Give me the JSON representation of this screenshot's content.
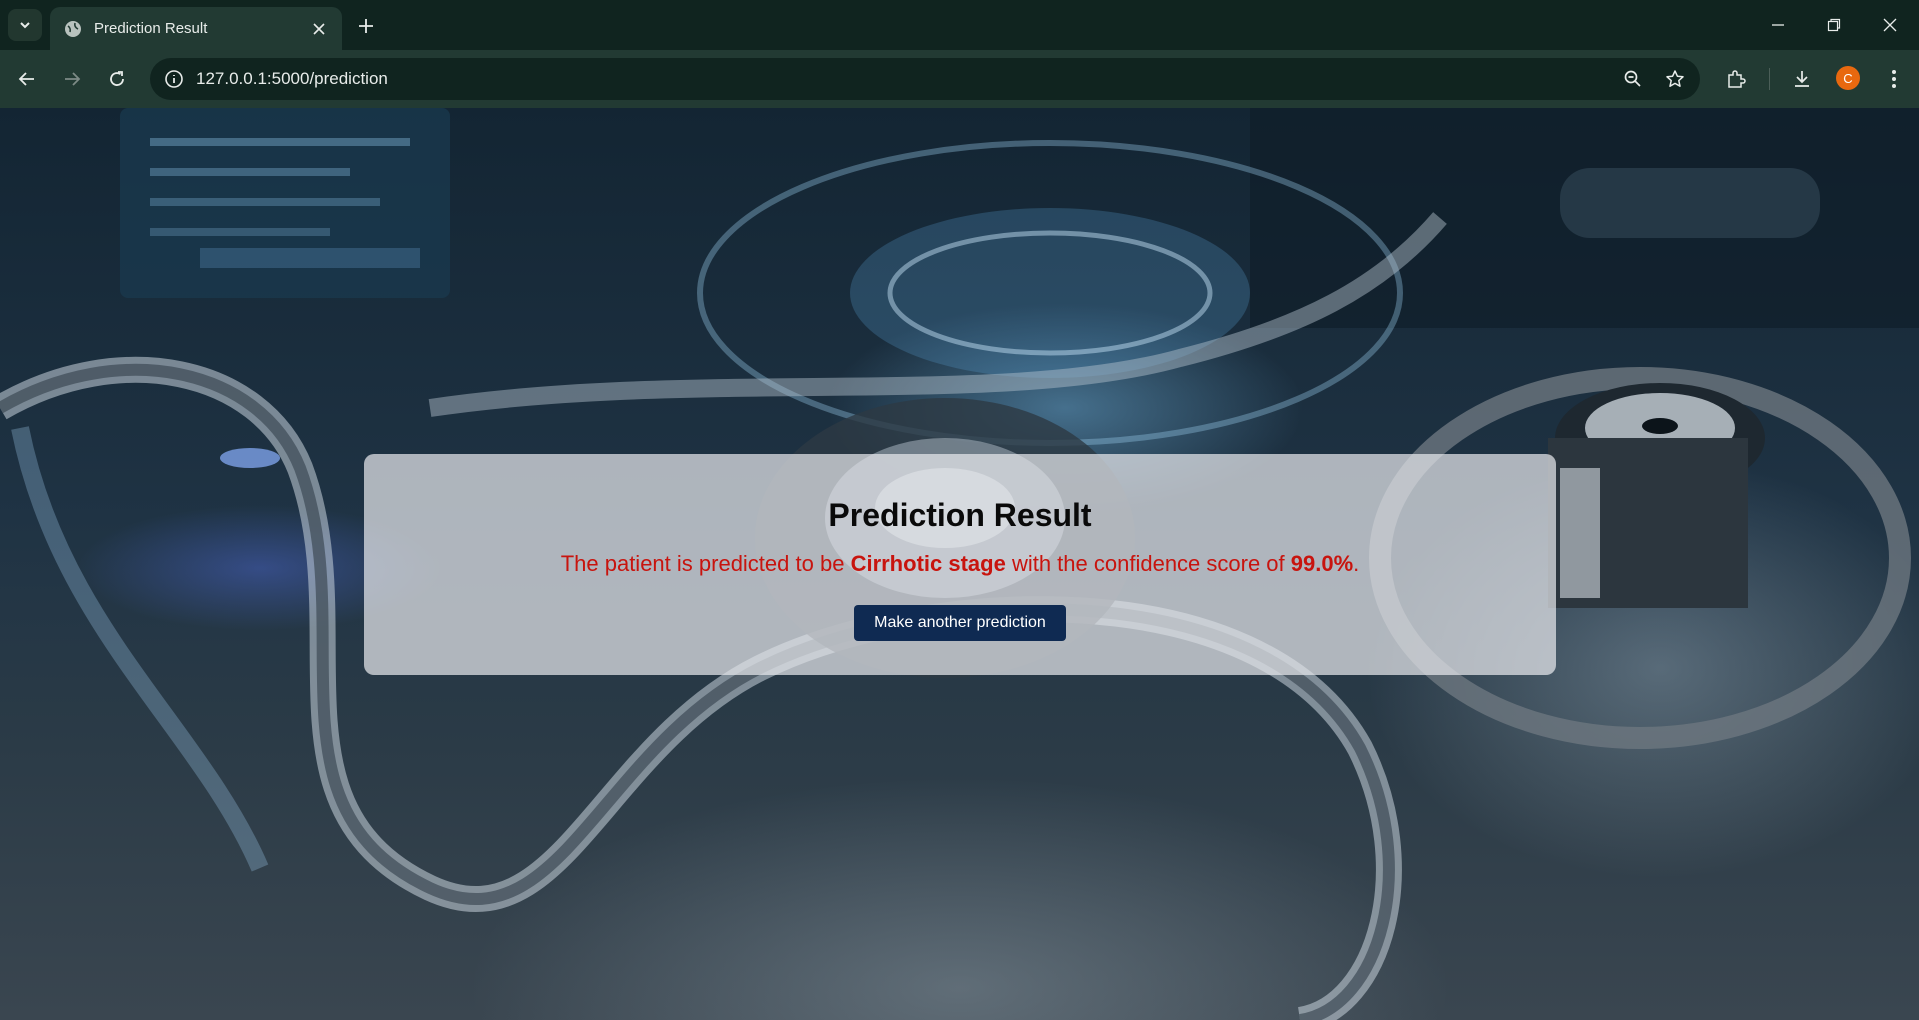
{
  "browser": {
    "tab_title": "Prediction Result",
    "url": "127.0.0.1:5000/prediction",
    "profile_initial": "C"
  },
  "page": {
    "title": "Prediction Result",
    "sentence_prefix": "The patient is predicted to be ",
    "stage": "Cirrhotic stage",
    "sentence_middle": " with the confidence score of ",
    "confidence": "99.0%",
    "sentence_suffix": ".",
    "button_label": "Make another prediction"
  },
  "colors": {
    "result_text": "#c8140e",
    "button_bg": "#0f2a52",
    "chrome_dark": "#10241f",
    "chrome_light": "#223a33"
  },
  "icons": [
    "tab-search-icon",
    "globe-icon",
    "close-icon",
    "plus-icon",
    "minimize-icon",
    "restore-icon",
    "back-arrow-icon",
    "forward-arrow-icon",
    "reload-icon",
    "site-info-icon",
    "zoom-icon",
    "star-icon",
    "extensions-icon",
    "download-icon",
    "kebab-menu-icon"
  ]
}
